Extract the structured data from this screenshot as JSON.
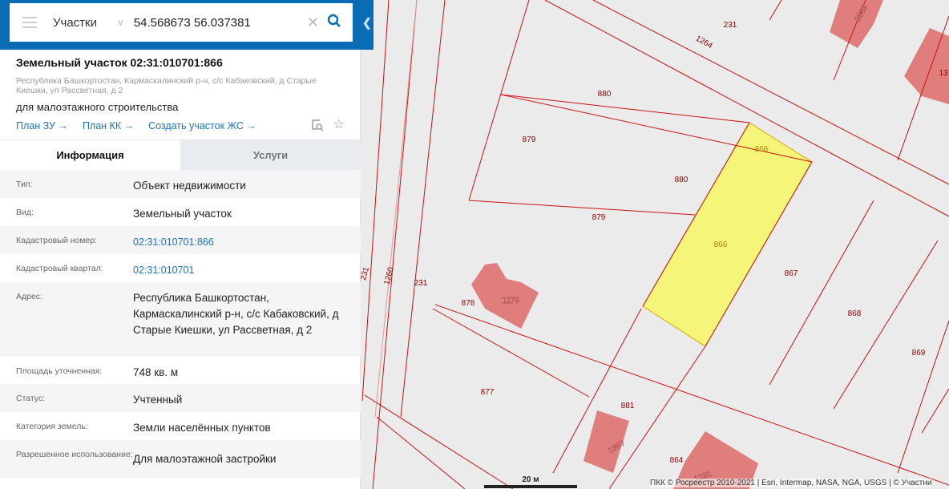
{
  "search": {
    "layer": "Участки",
    "query": "54.568673 56.037381"
  },
  "parcel": {
    "title": "Земельный участок 02:31:010701:866",
    "address": "Республика Башкортостан, Кармаскалинский р-н, с/с Кабаковский, д Старые Киешки, ул Рассветная, д 2",
    "purpose": "для малоэтажного строительства",
    "links": [
      "План ЗУ →",
      "План КК →",
      "Создать участок ЖС →"
    ]
  },
  "tabs": [
    "Информация",
    "Услуги"
  ],
  "rows": [
    {
      "label": "Тип:",
      "value": "Объект недвижимости"
    },
    {
      "label": "Вид:",
      "value": "Земельный участок"
    },
    {
      "label": "Кадастровый номер:",
      "value": "02:31:010701:866"
    },
    {
      "label": "Кадастровый квартал:",
      "value": "02:31:010701"
    },
    {
      "label": "Адрес:",
      "value": "Республика Башкортостан, Кармаскалинский р-н, с/с Кабаковский, д Старые Киешки, ул Рассветная, д 2"
    },
    {
      "label": "Площадь уточненная:",
      "value": "748 кв. м"
    },
    {
      "label": "Статус:",
      "value": "Учтенный"
    },
    {
      "label": "Категория земель:",
      "value": "Земли населённых пунктов"
    },
    {
      "label": "Разрешенное использование:",
      "value": "Для малоэтажной застройки"
    }
  ],
  "map": {
    "labels": [
      "231",
      "1264",
      "880",
      "879",
      "866",
      "880",
      "879",
      "866",
      "867",
      "868",
      "869",
      "878",
      "1279",
      "877",
      "881",
      "1857",
      "864",
      "1291",
      "231",
      "1260",
      "231",
      "1889",
      "13"
    ],
    "scale": "20 м",
    "attribution": "ПКК © Росреестр 2010-2021 | Esri, Intermap, NASA, NGA, USGS | © Участни"
  },
  "colors": {
    "accent": "#0a6cb5",
    "highlight": "#f5f57a",
    "building": "#e08080",
    "boundary": "#cc0000"
  }
}
